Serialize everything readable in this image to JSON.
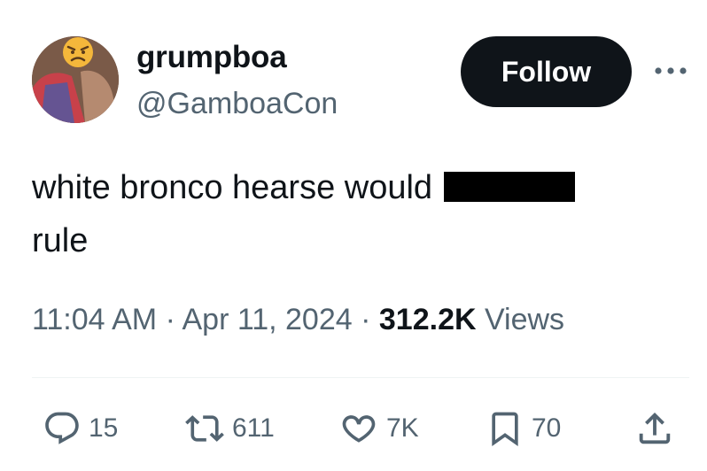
{
  "user": {
    "display_name": "grumpboa",
    "handle": "@GamboaCon",
    "avatar_badge_icon": "angry-face-emoji"
  },
  "header": {
    "follow_label": "Follow",
    "more_icon": "ellipsis-icon"
  },
  "tweet": {
    "text_before": "white bronco hearse would ",
    "text_after": "rule",
    "redaction_color": "#000000"
  },
  "meta": {
    "time": "11:04 AM",
    "separator": " · ",
    "date": "Apr 11, 2024",
    "views_count": "312.2K",
    "views_label": " Views"
  },
  "actions": {
    "replies": "15",
    "reposts": "611",
    "likes": "7K",
    "bookmarks": "70"
  },
  "colors": {
    "text": "#0f1419",
    "secondary": "#536471",
    "button_bg": "#0f1419",
    "divider": "#eff3f4"
  }
}
